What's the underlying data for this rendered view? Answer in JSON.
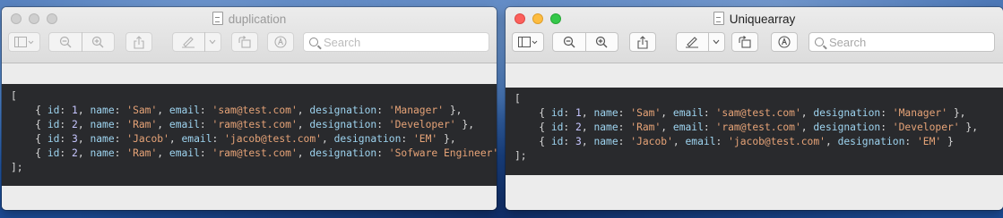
{
  "windows": [
    {
      "title": "duplication",
      "state": "inactive",
      "search_placeholder": "Search",
      "code": {
        "open": "[",
        "close": "];",
        "rows": [
          {
            "id": "1",
            "name": "'Sam'",
            "email": "'sam@test.com'",
            "designation": "'Manager'"
          },
          {
            "id": "2",
            "name": "'Ram'",
            "email": "'ram@test.com'",
            "designation": "'Developer'"
          },
          {
            "id": "3",
            "name": "'Jacob'",
            "email": "'jacob@test.com'",
            "designation": "'EM'"
          },
          {
            "id": "2",
            "name": "'Ram'",
            "email": "'ram@test.com'",
            "designation": "'Sofware Engineer'"
          }
        ]
      }
    },
    {
      "title": "Uniquearray",
      "state": "active",
      "search_placeholder": "Search",
      "code": {
        "open": "[",
        "close": "];",
        "rows": [
          {
            "id": "1",
            "name": "'Sam'",
            "email": "'sam@test.com'",
            "designation": "'Manager'"
          },
          {
            "id": "2",
            "name": "'Ram'",
            "email": "'ram@test.com'",
            "designation": "'Developer'"
          },
          {
            "id": "3",
            "name": "'Jacob'",
            "email": "'jacob@test.com'",
            "designation": "'EM'"
          }
        ]
      }
    }
  ],
  "toolbar_icons": [
    "sidebar-icon",
    "zoom-out-icon",
    "zoom-in-icon",
    "share-icon",
    "markup-pen-icon",
    "rotate-icon",
    "annotate-icon",
    "search-icon"
  ],
  "colors": {
    "code_background": "#292a2d",
    "code_key": "#9ed4f0",
    "code_string": "#e6a377",
    "close_light": "#fc605c",
    "minimize_light": "#fdbc40",
    "zoom_light": "#34c84a"
  }
}
